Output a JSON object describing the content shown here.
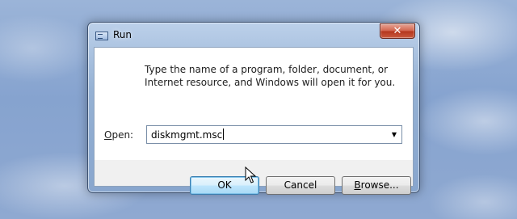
{
  "window": {
    "title": "Run",
    "close_label": "✕"
  },
  "dialog": {
    "description": "Type the name of a program, folder, document, or Internet resource, and Windows will open it for you.",
    "open_label_prefix": "O",
    "open_label_rest": "pen:",
    "open_value": "diskmgmt.msc",
    "dropdown_arrow": "▼"
  },
  "buttons": {
    "ok": "OK",
    "cancel": "Cancel",
    "browse_prefix": "B",
    "browse_rest": "rowse..."
  },
  "icons": {
    "window_icon": "run-window-icon",
    "close": "close-icon",
    "dropdown": "chevron-down-icon",
    "cursor": "mouse-pointer-icon"
  }
}
